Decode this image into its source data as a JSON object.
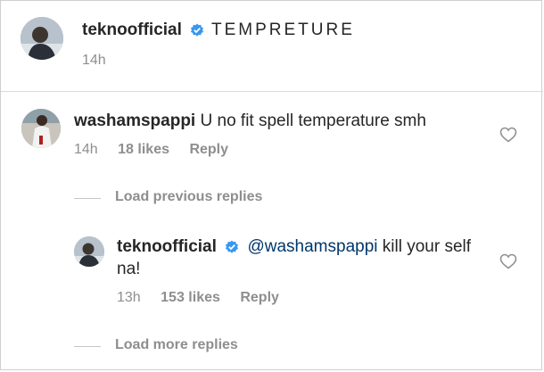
{
  "caption": {
    "username": "teknoofficial",
    "text": "TEMPRETURE",
    "time": "14h"
  },
  "comment1": {
    "username": "washamspappi",
    "text": "U no fit spell temperature smh",
    "time": "14h",
    "likes": "18 likes",
    "reply_label": "Reply"
  },
  "load_previous": "Load previous replies",
  "reply1": {
    "username": "teknoofficial",
    "mention": "@washamspappi",
    "text": " kill your self na!",
    "time": "13h",
    "likes": "153 likes",
    "reply_label": "Reply"
  },
  "load_more": "Load more replies",
  "colors": {
    "verified": "#3897f0",
    "mention": "#00376b",
    "muted": "#8e8e8e"
  },
  "icons": [
    "verified-badge-icon",
    "heart-icon"
  ]
}
